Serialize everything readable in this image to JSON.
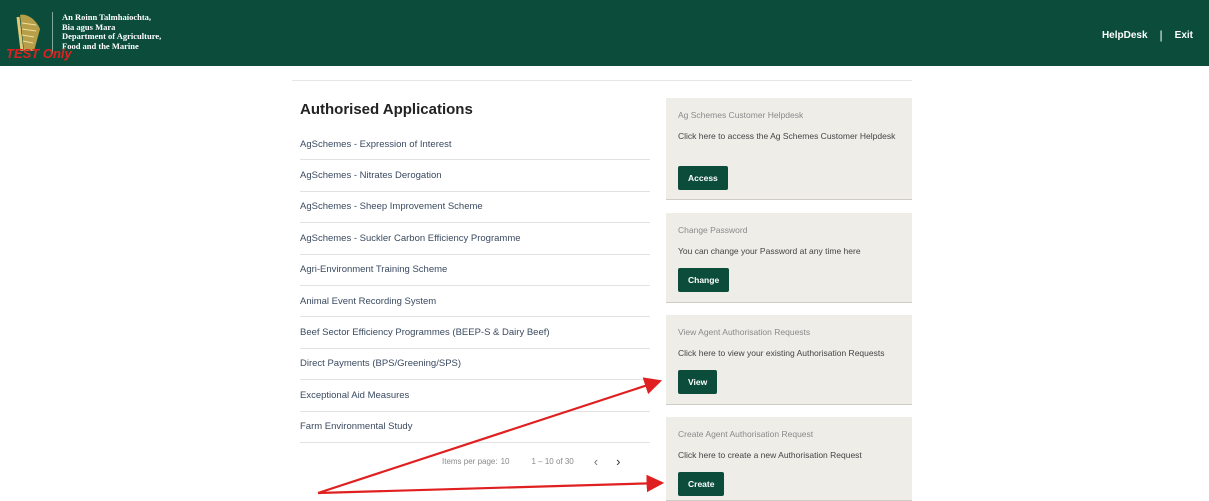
{
  "header": {
    "dept_lines": [
      "An Roinn Talmhaíochta,",
      "Bia agus Mara",
      "Department of Agriculture,",
      "Food and the Marine"
    ],
    "test_label": "TEST Only",
    "nav": {
      "helpdesk": "HelpDesk",
      "separator": "|",
      "exit": "Exit"
    }
  },
  "applications": {
    "title": "Authorised Applications",
    "items": [
      "AgSchemes - Expression of Interest",
      "AgSchemes - Nitrates Derogation",
      "AgSchemes - Sheep Improvement Scheme",
      "AgSchemes - Suckler Carbon Efficiency Programme",
      "Agri-Environment Training Scheme",
      "Animal Event Recording System",
      "Beef Sector Efficiency Programmes (BEEP-S & Dairy Beef)",
      "Direct Payments (BPS/Greening/SPS)",
      "Exceptional Aid Measures",
      "Farm Environmental Study"
    ],
    "pager": {
      "items_per_page_label": "Items per page:",
      "items_per_page": "10",
      "range": "1 – 10 of 30",
      "prev": "‹",
      "next": "›"
    }
  },
  "cards": [
    {
      "title": "Ag Schemes Customer Helpdesk",
      "desc": "Click here to access the Ag Schemes Customer Helpdesk",
      "button": "Access"
    },
    {
      "title": "Change Password",
      "desc": "You can change your Password at any time here",
      "button": "Change"
    },
    {
      "title": "View Agent Authorisation Requests",
      "desc": "Click here to view your existing Authorisation Requests",
      "button": "View"
    },
    {
      "title": "Create Agent Authorisation Request",
      "desc": "Click here to create a new Authorisation Request",
      "button": "Create"
    }
  ],
  "colors": {
    "header_bg": "#0b4d3a",
    "button_bg": "#0b4d3a",
    "card_bg": "#efede8",
    "annotation_arrow": "#e02020"
  }
}
